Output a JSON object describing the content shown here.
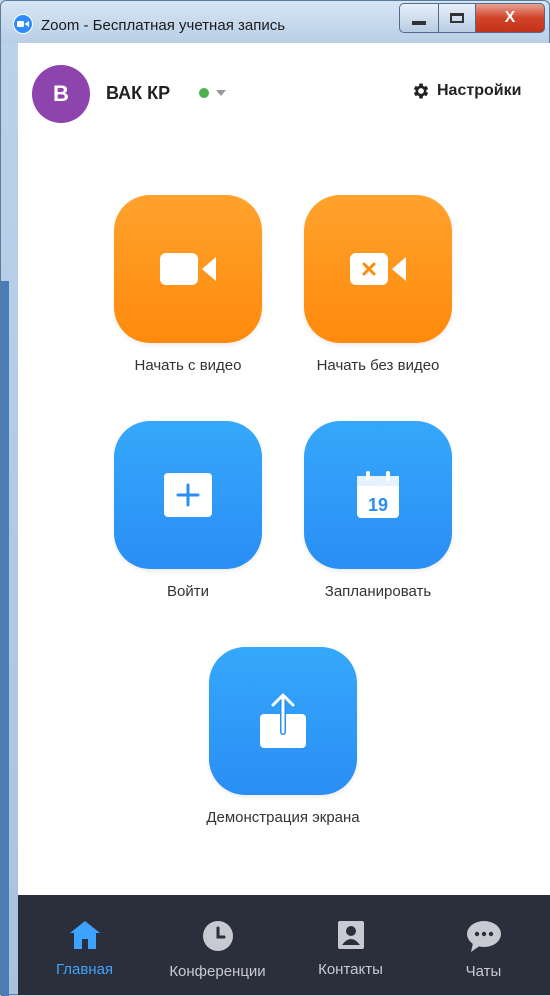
{
  "window": {
    "title": "Zoom - Бесплатная учетная запись",
    "close_label": "X"
  },
  "header": {
    "avatar_initial": "B",
    "username": "ВАК КР",
    "status": "online",
    "settings_label": "Настройки"
  },
  "actions": {
    "new_meeting_video": "Начать с видео",
    "new_meeting_no_video": "Начать без видео",
    "join": "Войти",
    "schedule": "Запланировать",
    "share_screen": "Демонстрация экрана",
    "calendar_day": "19"
  },
  "nav": {
    "home": "Главная",
    "meetings": "Конференции",
    "contacts": "Контакты",
    "chats": "Чаты",
    "active": "home"
  },
  "colors": {
    "orange": "#ff8a0c",
    "blue": "#2a8ef5",
    "nav_bg": "#2b2f3b",
    "nav_active": "#3ea2ff",
    "avatar": "#8e44ad",
    "status_online": "#4caf50"
  }
}
